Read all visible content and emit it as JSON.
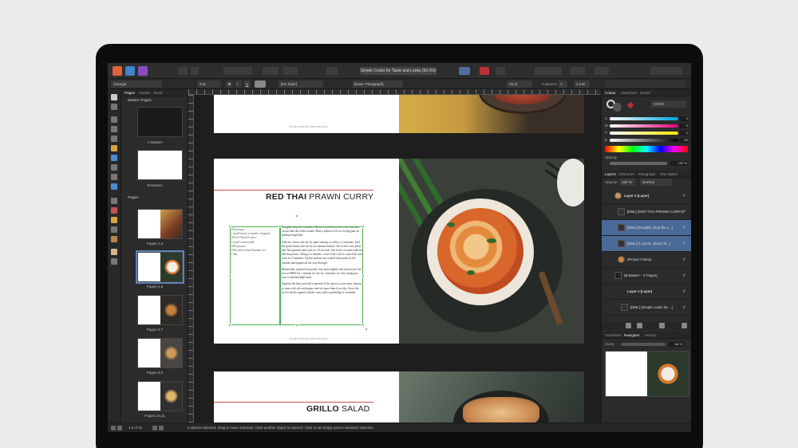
{
  "app": {
    "document_title": "Simple Cooks for Taste and Looks (50.0%)",
    "personas": [
      "publisher",
      "designer",
      "photo"
    ]
  },
  "context_bar": {
    "font": "Georgia",
    "size": "9 pt",
    "bold": "B",
    "italic": "I",
    "underline": "U",
    "char_style": "[No Style]",
    "para_style": "[Basic Paragraph]",
    "leading": "16 pt",
    "columns_label": "Columns:",
    "columns": "1",
    "gutter": "2 mm"
  },
  "left_panel": {
    "tabs": [
      "Pages",
      "Assets",
      "Stock"
    ],
    "master_header": "Master Pages",
    "masters": [
      "A-Master",
      "B-Master"
    ],
    "pages_header": "Pages",
    "spreads": [
      "Pages 2,3",
      "Pages 4,5",
      "Pages 6,7",
      "Pages 8,9",
      "Pages 10,11"
    ]
  },
  "canvas": {
    "top_footer": "Simple cooks for taste and looks",
    "heading1_bold": "RED THAI",
    "heading1_rest": " PRAWN CURRY",
    "ingredients": "100 g sugar\n1 small bunch coriander, chopped\n100 ml Thai fish sauce\n1 small coconut milk\n1000 prawns\n1000 pack cooked basmati rice\n1 lime",
    "method": [
      "Roughly chop the coriander. Remove and discard the ends from the cactus then slice thin rounds. Heat a splash of oil in a frying pan on medium-high heat.",
      "Add the carrots and stir fry until starting to soften, a 2 minutes. Add the green beans and stir fry for another minute. Stir in the curry paste and Thai garnish and cook for 30 seconds. Stir in the coconut milk and add the prawns. Bring to a simmer, cover with a lid (or some foil) and cook for 5 minutes. Tip the prawns are cooked when pink on the outside and opaque all the way through.",
      "Meanwhile, squeeze the pouch, tear open slightly and microwave the rice at 900W for 1 minute (or stir fry 3 minutes in a dry frying pan over a medium-high heat).",
      "Squeeze the lime and add a squeeze of the juice to your curry. Season to taste with salt and pepper and stir more than if too dry. Serve the rice in bowls topped with the curry and a sprinkling of coriander."
    ],
    "mid_footer": "Simple cooks for taste and looks",
    "heading2_bold": "GRILLO",
    "heading2_rest": " SALAD"
  },
  "right_panel": {
    "top_tabs": [
      "Colour",
      "Swatches",
      "Stroke"
    ],
    "color_model": "CMYK",
    "channels": [
      {
        "label": "C",
        "value": "0"
      },
      {
        "label": "M",
        "value": "0"
      },
      {
        "label": "Y",
        "value": "0"
      },
      {
        "label": "K",
        "value": "80"
      }
    ],
    "opacity_label": "Opacity",
    "opacity_value": "100 %",
    "layer_tabs": [
      "Layers",
      "Character",
      "Paragraph",
      "Text Styles"
    ],
    "layer_opacity_label": "Opacity:",
    "layer_opacity": "100 %",
    "blend_mode": "Normal",
    "layers": [
      {
        "name": "Layer 1 (Layer)",
        "selected": false,
        "indent": 0
      },
      {
        "name": "[DML] (RED THAI PRAWN CURRY)",
        "selected": false,
        "indent": 1
      },
      {
        "name": "[DML] (Roughly chop the c...)",
        "selected": true,
        "indent": 1
      },
      {
        "name": "[DML] (1 carrot, sliced, th...)",
        "selected": true,
        "indent": 1
      },
      {
        "name": "(Picture Frame)",
        "selected": false,
        "indent": 1
      },
      {
        "name": "(B-Master – 2 Pages)",
        "selected": false,
        "indent": 0
      },
      {
        "name": "Layer 1 (Layer)",
        "selected": false,
        "indent": 1
      },
      {
        "name": "[DML] (Simple cooks for ...)",
        "selected": false,
        "indent": 2
      }
    ],
    "bottom_tabs": [
      "Transform",
      "Navigator",
      "History"
    ],
    "zoom_label": "Zoom:",
    "zoom_value": "66 %"
  },
  "status": {
    "page_indicator": "4,5 of 12",
    "message": "2 objects selected. Drag to move selection. Click another object to select it. Click on an empty area to deselect selection."
  }
}
